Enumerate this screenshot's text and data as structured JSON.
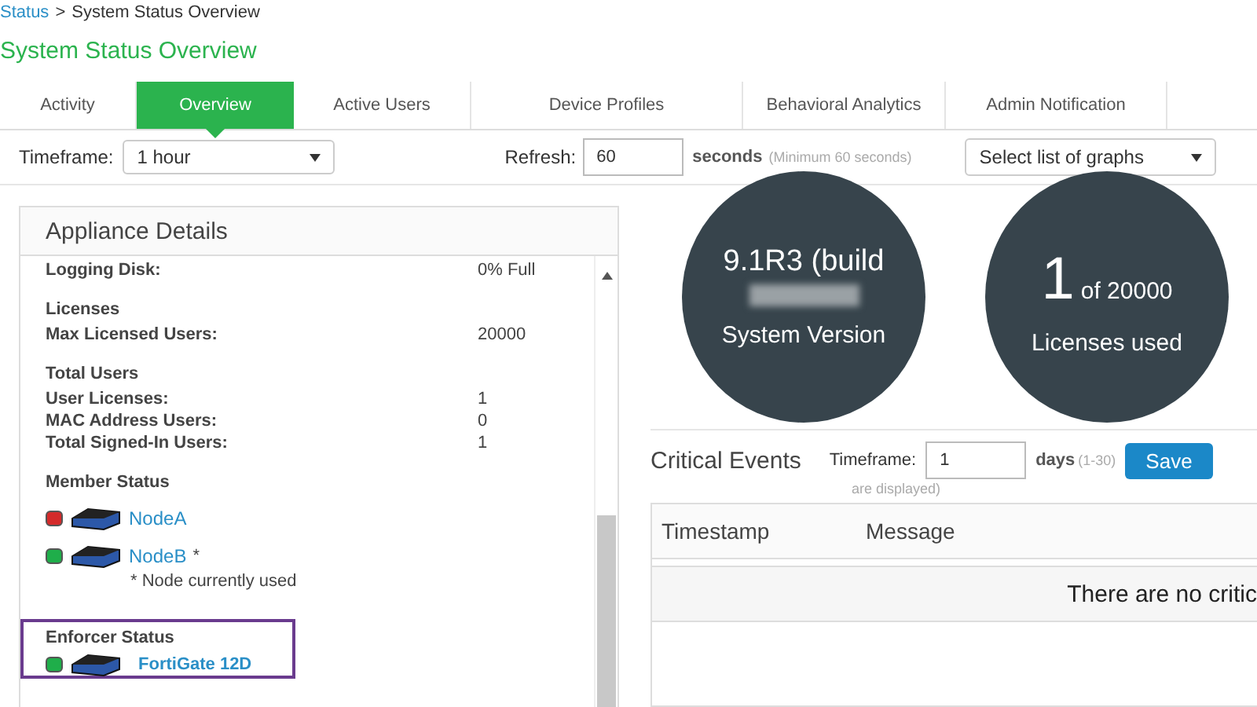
{
  "breadcrumb": {
    "link": "Status",
    "separator": ">",
    "current": "System Status Overview"
  },
  "title": "System Status Overview",
  "tabs": [
    {
      "label": "Activity",
      "selected": false
    },
    {
      "label": "Overview",
      "selected": true
    },
    {
      "label": "Active Users",
      "selected": false
    },
    {
      "label": "Device Profiles",
      "selected": false
    },
    {
      "label": "Behavioral Analytics",
      "selected": false
    },
    {
      "label": "Admin Notification",
      "selected": false
    }
  ],
  "toolbar": {
    "timeframe_label": "Timeframe:",
    "timeframe_value": "1 hour",
    "refresh_label": "Refresh:",
    "refresh_value": "60",
    "refresh_unit": "seconds",
    "refresh_hint": "(Minimum 60 seconds)",
    "graphs_button": "Select list of graphs"
  },
  "appliance_details": {
    "title": "Appliance Details",
    "sections": [
      {
        "rows": [
          {
            "label": "Logging Disk:",
            "value": "0% Full"
          }
        ]
      },
      {
        "heading": "Licenses",
        "rows": [
          {
            "label": "Max Licensed Users:",
            "value": "20000"
          }
        ]
      },
      {
        "heading": "Total Users",
        "rows": [
          {
            "label": "User Licenses:",
            "value": "1"
          },
          {
            "label": "MAC Address Users:",
            "value": "0"
          },
          {
            "label": "Total Signed-In Users:",
            "value": "1"
          }
        ]
      }
    ],
    "member_status": {
      "heading": "Member Status",
      "nodes": [
        {
          "name": "NodeA",
          "color": "#d42a2a"
        },
        {
          "name": "NodeB",
          "suffix": "*",
          "color": "#1fae4a"
        }
      ],
      "note": "* Node currently used"
    },
    "enforcer_status": {
      "heading": "Enforcer Status",
      "nodes": [
        {
          "name": "FortiGate 12D",
          "color": "#1fae4a"
        }
      ]
    }
  },
  "system_version": {
    "value": "9.1R3 (build",
    "label": "System Version"
  },
  "licenses_used": {
    "count": "1",
    "of": "of 20000",
    "label": "Licenses used"
  },
  "critical_events": {
    "title": "Critical Events",
    "timeframe_label": "Timeframe:",
    "timeframe_value": "1",
    "unit": "days",
    "range": "(1-30)",
    "save": "Save",
    "note": "are displayed)",
    "columns": [
      "Timestamp",
      "Message"
    ],
    "empty": "There are no critic"
  }
}
